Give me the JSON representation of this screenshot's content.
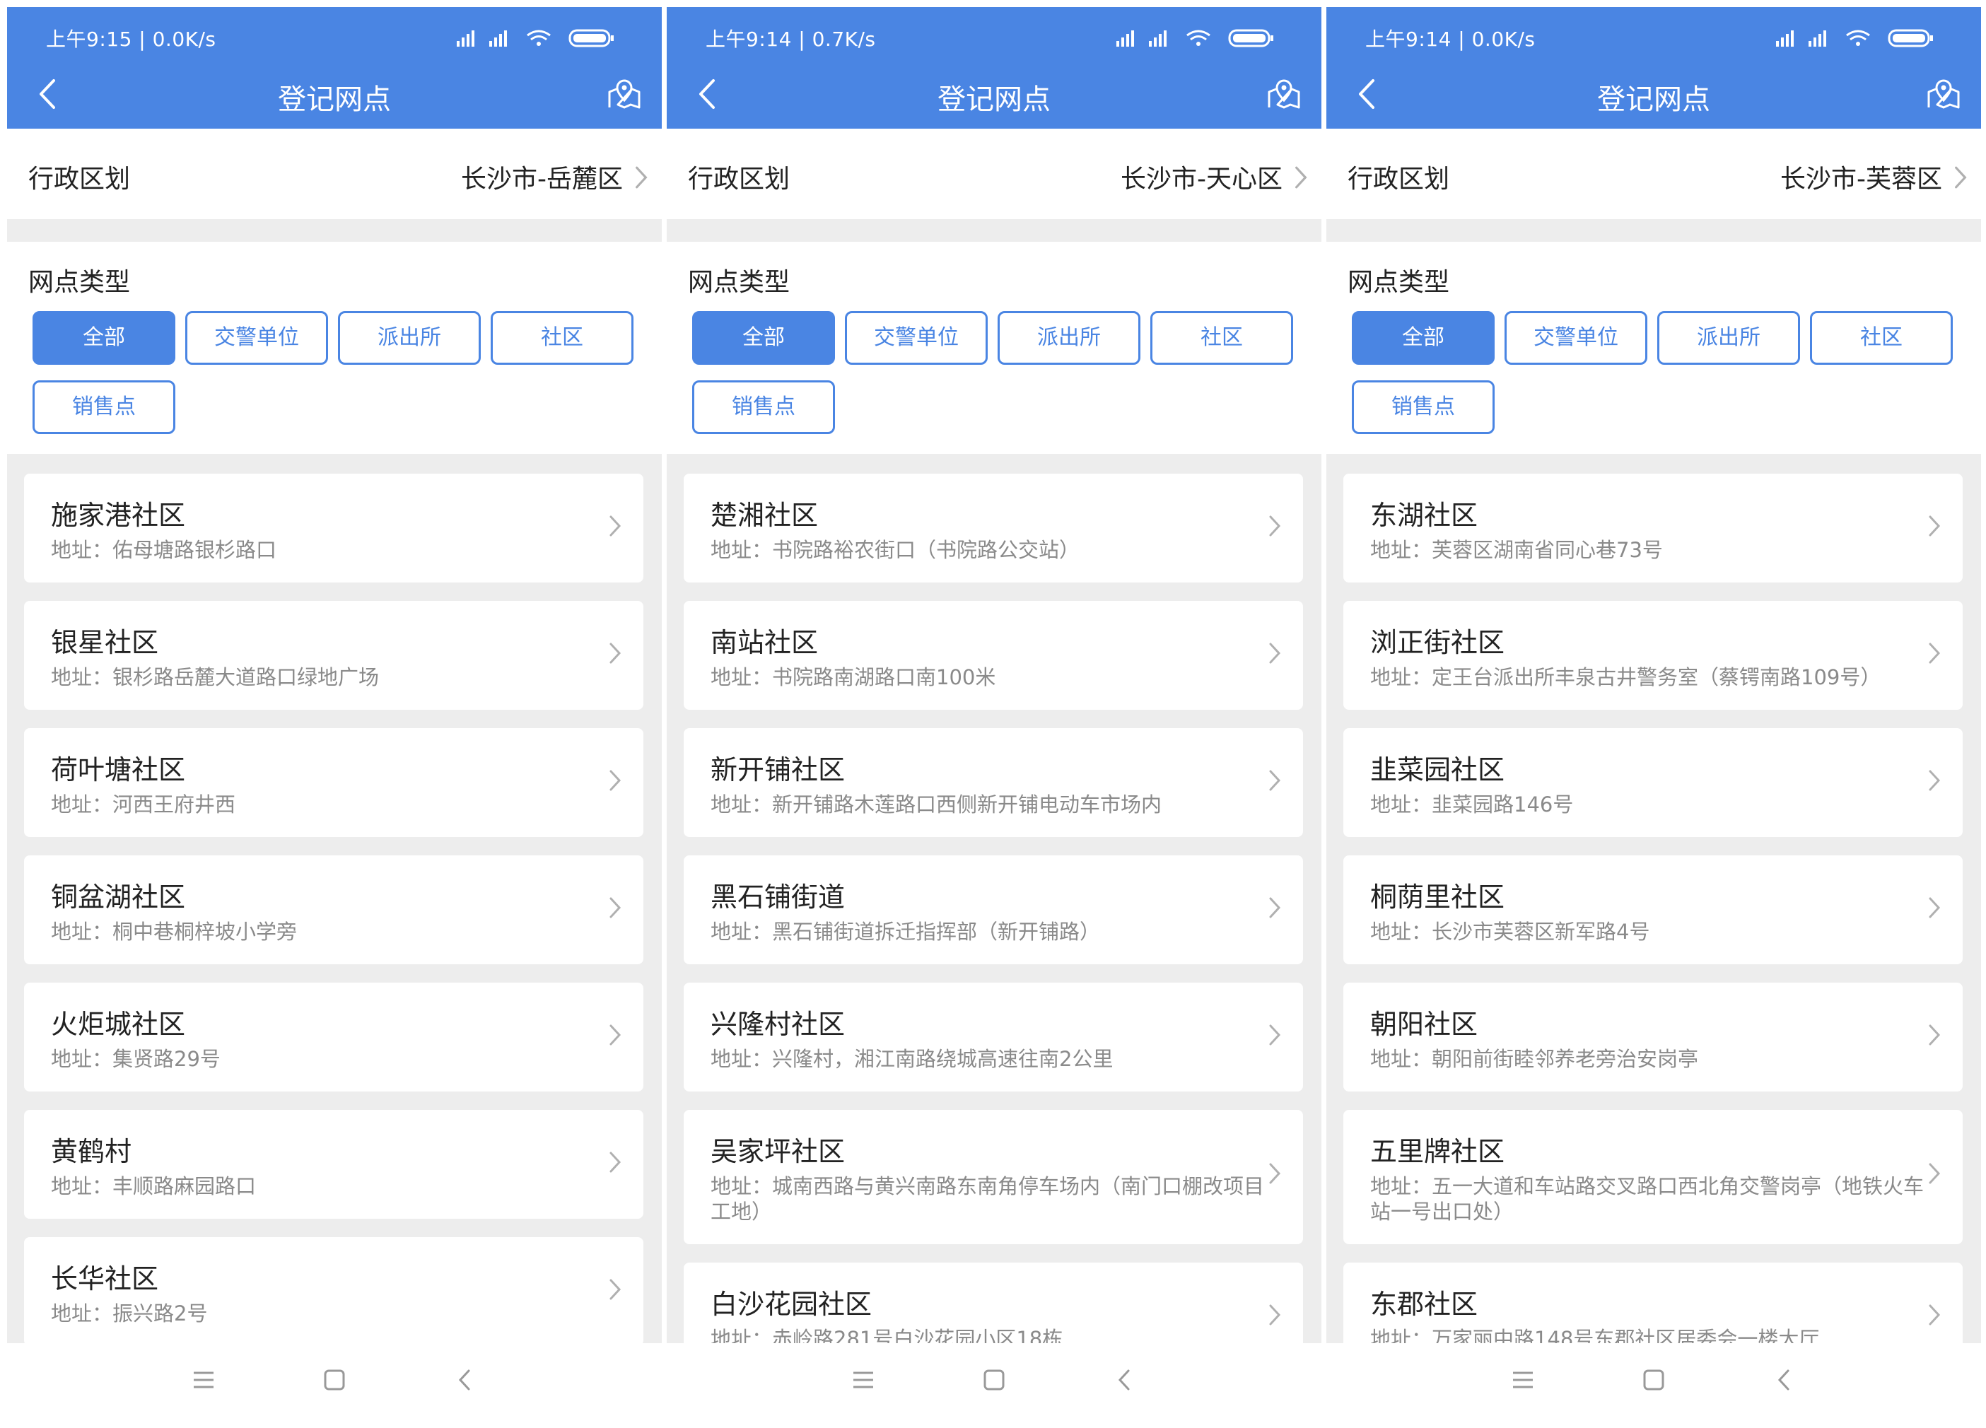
{
  "colors": {
    "accent": "#4a85e3",
    "text": "#222222",
    "subtext": "#8a8a8a",
    "bg": "#ededed"
  },
  "screens": [
    {
      "status_time": "上午9:15 | 0.0K/s",
      "title": "登记网点",
      "region_label": "行政区划",
      "region_value": "长沙市-岳麓区",
      "types_label": "网点类型",
      "chips": [
        "全部",
        "交警单位",
        "派出所",
        "社区",
        "销售点"
      ],
      "active_chip": "全部",
      "items": [
        {
          "name": "施家港社区",
          "address": "地址：佑母塘路银杉路口"
        },
        {
          "name": "银星社区",
          "address": "地址：银杉路岳麓大道路口绿地广场"
        },
        {
          "name": "荷叶塘社区",
          "address": "地址：河西王府井西"
        },
        {
          "name": "铜盆湖社区",
          "address": "地址：桐中巷桐梓坡小学旁"
        },
        {
          "name": "火炬城社区",
          "address": "地址：集贤路29号"
        },
        {
          "name": "黄鹤村",
          "address": "地址：丰顺路麻园路口"
        },
        {
          "name": "长华社区",
          "address": "地址：振兴路2号"
        }
      ]
    },
    {
      "status_time": "上午9:14 | 0.7K/s",
      "title": "登记网点",
      "region_label": "行政区划",
      "region_value": "长沙市-天心区",
      "types_label": "网点类型",
      "chips": [
        "全部",
        "交警单位",
        "派出所",
        "社区",
        "销售点"
      ],
      "active_chip": "全部",
      "items": [
        {
          "name": "楚湘社区",
          "address": "地址：书院路裕农街口（书院路公交站）"
        },
        {
          "name": "南站社区",
          "address": "地址：书院路南湖路口南100米"
        },
        {
          "name": "新开铺社区",
          "address": "地址：新开铺路木莲路口西侧新开铺电动车市场内"
        },
        {
          "name": "黑石铺街道",
          "address": "地址：黑石铺街道拆迁指挥部（新开铺路）"
        },
        {
          "name": "兴隆村社区",
          "address": "地址：兴隆村，湘江南路绕城高速往南2公里"
        },
        {
          "name": "吴家坪社区",
          "address": "地址：城南西路与黄兴南路东南角停车场内（南门口棚改项目工地）"
        },
        {
          "name": "白沙花园社区",
          "address": "地址：赤岭路281号白沙花园小区18栋"
        }
      ]
    },
    {
      "status_time": "上午9:14 | 0.0K/s",
      "title": "登记网点",
      "region_label": "行政区划",
      "region_value": "长沙市-芙蓉区",
      "types_label": "网点类型",
      "chips": [
        "全部",
        "交警单位",
        "派出所",
        "社区",
        "销售点"
      ],
      "active_chip": "全部",
      "items": [
        {
          "name": "东湖社区",
          "address": "地址：芙蓉区湖南省同心巷73号"
        },
        {
          "name": "浏正街社区",
          "address": "地址：定王台派出所丰泉古井警务室（蔡锷南路109号）"
        },
        {
          "name": "韭菜园社区",
          "address": "地址：韭菜园路146号"
        },
        {
          "name": "桐荫里社区",
          "address": "地址：长沙市芙蓉区新军路4号"
        },
        {
          "name": "朝阳社区",
          "address": "地址：朝阳前街睦邻养老旁治安岗亭"
        },
        {
          "name": "五里牌社区",
          "address": "地址：五一大道和车站路交叉路口西北角交警岗亭（地铁火车站一号出口处）"
        },
        {
          "name": "东郡社区",
          "address": "地址：万家丽中路148号东郡社区居委会一楼大厅"
        }
      ]
    }
  ]
}
